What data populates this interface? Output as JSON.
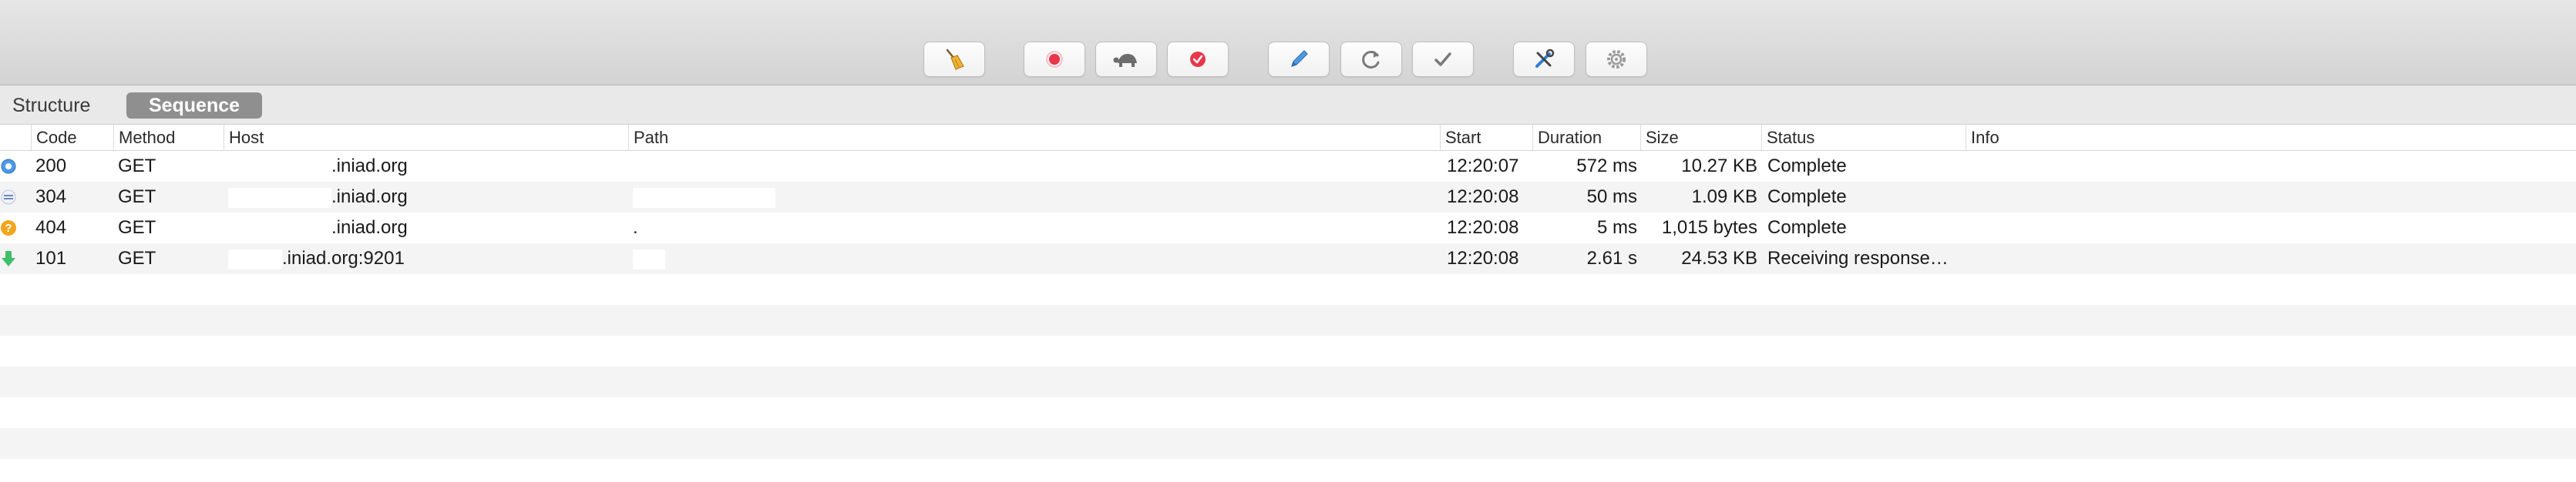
{
  "toolbar": {
    "buttons": [
      {
        "name": "clear-button",
        "icon": "broom-icon"
      },
      {
        "name": "record-button",
        "icon": "record-icon"
      },
      {
        "name": "throttle-button",
        "icon": "turtle-icon"
      },
      {
        "name": "breakpoints-button",
        "icon": "breakpoint-icon"
      },
      {
        "name": "edit-button",
        "icon": "pen-icon"
      },
      {
        "name": "repeat-button",
        "icon": "refresh-icon"
      },
      {
        "name": "validate-button",
        "icon": "check-icon"
      },
      {
        "name": "tools-button",
        "icon": "tools-icon"
      },
      {
        "name": "settings-button",
        "icon": "gear-icon"
      }
    ],
    "colors": {
      "record": "#e8374a",
      "breakpoint": "#e8374a",
      "pen": "#2f7fd6"
    }
  },
  "tabs": {
    "structure": "Structure",
    "sequence": "Sequence",
    "active": "Sequence"
  },
  "table": {
    "columns": {
      "code": "Code",
      "method": "Method",
      "host": "Host",
      "path": "Path",
      "start": "Start",
      "duration": "Duration",
      "size": "Size",
      "status": "Status",
      "info": "Info"
    },
    "rows": [
      {
        "icon": "info-icon",
        "code": "200",
        "method": "GET",
        "host": ".iniad.org",
        "path": "",
        "start": "12:20:07",
        "duration": "572 ms",
        "size": "10.27 KB",
        "status": "Complete",
        "info": ""
      },
      {
        "icon": "equals-icon",
        "code": "304",
        "method": "GET",
        "host": ".iniad.org",
        "path": "",
        "start": "12:20:08",
        "duration": "50 ms",
        "size": "1.09 KB",
        "status": "Complete",
        "info": ""
      },
      {
        "icon": "question-icon",
        "code": "404",
        "method": "GET",
        "host": ".iniad.org",
        "path": ".",
        "start": "12:20:08",
        "duration": "5 ms",
        "size": "1,015 bytes",
        "status": "Complete",
        "info": ""
      },
      {
        "icon": "download-arrow-icon",
        "code": "101",
        "method": "GET",
        "host": ".iniad.org:9201",
        "path": "",
        "start": "12:20:08",
        "duration": "2.61 s",
        "size": "24.53 KB",
        "status": "Receiving response…",
        "info": ""
      }
    ]
  }
}
